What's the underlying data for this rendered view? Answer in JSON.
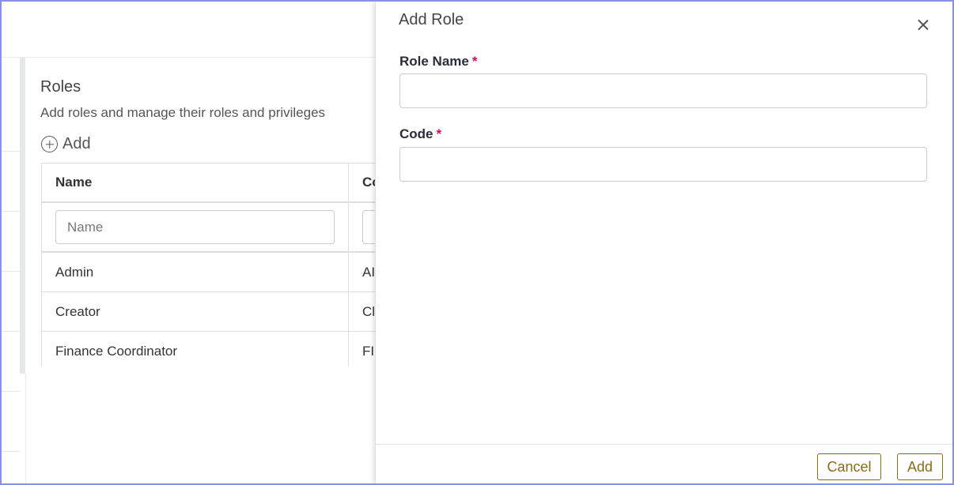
{
  "roles_panel": {
    "title": "Roles",
    "description": "Add roles and manage their roles and privileges",
    "add_label": "Add",
    "add_icon": "plus-circle-icon",
    "table": {
      "columns": [
        "Name",
        "Co"
      ],
      "filter_placeholder": "Name",
      "rows": [
        {
          "name": "Admin",
          "code": "AI"
        },
        {
          "name": "Creator",
          "code": "Cl"
        },
        {
          "name": "Finance Coordinator",
          "code": "FI"
        }
      ]
    }
  },
  "drawer": {
    "title": "Add Role",
    "close_icon": "close-icon",
    "fields": [
      {
        "label": "Role Name",
        "required_mark": "*",
        "value": ""
      },
      {
        "label": "Code",
        "required_mark": "*",
        "value": ""
      }
    ],
    "cancel_label": "Cancel",
    "add_label": "Add"
  },
  "colors": {
    "accent": "#8b6a19",
    "required": "#d0115a",
    "frame": "#8a8fe8"
  }
}
